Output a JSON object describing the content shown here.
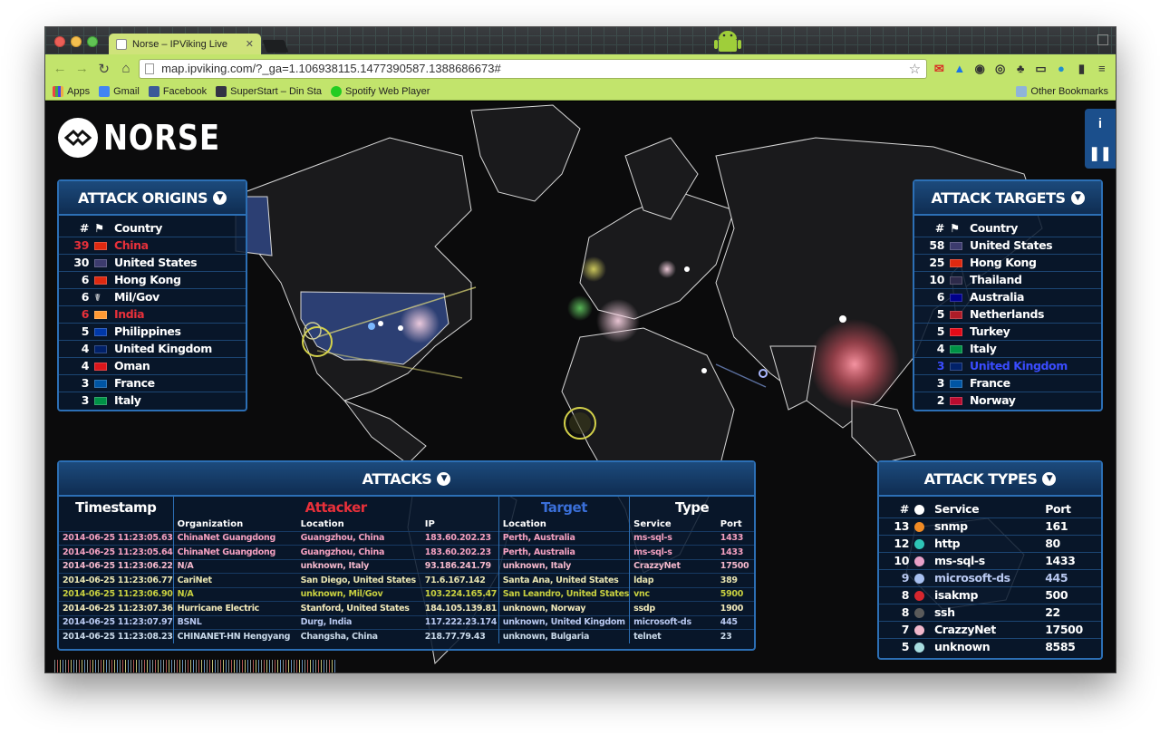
{
  "browser": {
    "tab_title": "Norse – IPViking Live",
    "url": "map.ipviking.com/?_ga=1.106938115.1477390587.1388686673#",
    "bookmarks": [
      "Apps",
      "Gmail",
      "Facebook",
      "SuperStart – Din Sta",
      "Spotify Web Player"
    ],
    "other_bookmarks": "Other Bookmarks"
  },
  "logo": {
    "text": "NORSE"
  },
  "side_buttons": {
    "info": "i",
    "pause": "❚❚"
  },
  "origins": {
    "title": "ATTACK ORIGINS",
    "col_num": "#",
    "col_country": "Country",
    "rows": [
      {
        "count": "39",
        "country": "China",
        "flag_color": "#de2910",
        "highlight": "#e8303a"
      },
      {
        "count": "30",
        "country": "United States",
        "flag_color": "#3c3b6e",
        "highlight": ""
      },
      {
        "count": "6",
        "country": "Hong Kong",
        "flag_color": "#de2910",
        "highlight": ""
      },
      {
        "count": "6",
        "country": "Mil/Gov",
        "flag_color": "",
        "highlight": ""
      },
      {
        "count": "6",
        "country": "India",
        "flag_color": "#ff9933",
        "highlight": "#e8303a"
      },
      {
        "count": "5",
        "country": "Philippines",
        "flag_color": "#0038a8",
        "highlight": ""
      },
      {
        "count": "4",
        "country": "United Kingdom",
        "flag_color": "#012169",
        "highlight": ""
      },
      {
        "count": "4",
        "country": "Oman",
        "flag_color": "#db161b",
        "highlight": ""
      },
      {
        "count": "3",
        "country": "France",
        "flag_color": "#0055a4",
        "highlight": ""
      },
      {
        "count": "3",
        "country": "Italy",
        "flag_color": "#009246",
        "highlight": ""
      }
    ]
  },
  "targets": {
    "title": "ATTACK TARGETS",
    "col_num": "#",
    "col_country": "Country",
    "rows": [
      {
        "count": "58",
        "country": "United States",
        "flag_color": "#3c3b6e",
        "highlight": ""
      },
      {
        "count": "25",
        "country": "Hong Kong",
        "flag_color": "#de2910",
        "highlight": ""
      },
      {
        "count": "10",
        "country": "Thailand",
        "flag_color": "#2d2a4a",
        "highlight": ""
      },
      {
        "count": "6",
        "country": "Australia",
        "flag_color": "#00008b",
        "highlight": ""
      },
      {
        "count": "5",
        "country": "Netherlands",
        "flag_color": "#ae1c28",
        "highlight": ""
      },
      {
        "count": "5",
        "country": "Turkey",
        "flag_color": "#e30a17",
        "highlight": ""
      },
      {
        "count": "4",
        "country": "Italy",
        "flag_color": "#009246",
        "highlight": ""
      },
      {
        "count": "3",
        "country": "United Kingdom",
        "flag_color": "#012169",
        "highlight": "#3a4cff"
      },
      {
        "count": "3",
        "country": "France",
        "flag_color": "#0055a4",
        "highlight": ""
      },
      {
        "count": "2",
        "country": "Norway",
        "flag_color": "#ba0c2f",
        "highlight": ""
      }
    ]
  },
  "attack_types": {
    "title": "ATTACK TYPES",
    "col_num": "#",
    "col_service": "Service",
    "col_port": "Port",
    "rows": [
      {
        "count": "13",
        "service": "snmp",
        "port": "161",
        "dot": "#f08a24",
        "text_color": "#ffffff"
      },
      {
        "count": "12",
        "service": "http",
        "port": "80",
        "dot": "#2ec4b6",
        "text_color": "#ffffff"
      },
      {
        "count": "10",
        "service": "ms-sql-s",
        "port": "1433",
        "dot": "#e8a0c8",
        "text_color": "#ffffff"
      },
      {
        "count": "9",
        "service": "microsoft-ds",
        "port": "445",
        "dot": "#a8c0f0",
        "text_color": "#b8c8f0"
      },
      {
        "count": "8",
        "service": "isakmp",
        "port": "500",
        "dot": "#d6262e",
        "text_color": "#ffffff"
      },
      {
        "count": "8",
        "service": "ssh",
        "port": "22",
        "dot": "#5a5a5a",
        "text_color": "#ffffff"
      },
      {
        "count": "7",
        "service": "CrazzyNet",
        "port": "17500",
        "dot": "#f2b8cc",
        "text_color": "#ffffff"
      },
      {
        "count": "5",
        "service": "unknown",
        "port": "8585",
        "dot": "#a8dde0",
        "text_color": "#ffffff"
      }
    ]
  },
  "attacks": {
    "title": "ATTACKS",
    "group_timestamp": "Timestamp",
    "group_attacker": "Attacker",
    "group_target": "Target",
    "group_type": "Type",
    "sub_organization": "Organization",
    "sub_location": "Location",
    "sub_ip": "IP",
    "sub_target_location": "Location",
    "sub_service": "Service",
    "sub_port": "Port",
    "attacker_color": "#e8303a",
    "target_color": "#3a6fd8",
    "rows": [
      {
        "timestamp": "2014-06-25 11:23:05.63",
        "org": "ChinaNet Guangdong",
        "location": "Guangzhou, China",
        "ip": "183.60.202.23",
        "target": "Perth, Australia",
        "service": "ms-sql-s",
        "port": "1433",
        "color": "#f4a0c0"
      },
      {
        "timestamp": "2014-06-25 11:23:05.64",
        "org": "ChinaNet Guangdong",
        "location": "Guangzhou, China",
        "ip": "183.60.202.23",
        "target": "Perth, Australia",
        "service": "ms-sql-s",
        "port": "1433",
        "color": "#f4a0c0"
      },
      {
        "timestamp": "2014-06-25 11:23:06.22",
        "org": "N/A",
        "location": "unknown, Italy",
        "ip": "93.186.241.79",
        "target": "unknown, Italy",
        "service": "CrazzyNet",
        "port": "17500",
        "color": "#f4b8cc"
      },
      {
        "timestamp": "2014-06-25 11:23:06.77",
        "org": "CariNet",
        "location": "San Diego, United States",
        "ip": "71.6.167.142",
        "target": "Santa Ana, United States",
        "service": "ldap",
        "port": "389",
        "color": "#e8e4b0"
      },
      {
        "timestamp": "2014-06-25 11:23:06.90",
        "org": "N/A",
        "location": "unknown, Mil/Gov",
        "ip": "103.224.165.47",
        "target": "San Leandro, United States",
        "service": "vnc",
        "port": "5900",
        "color": "#c8d040"
      },
      {
        "timestamp": "2014-06-25 11:23:07.36",
        "org": "Hurricane Electric",
        "location": "Stanford, United States",
        "ip": "184.105.139.81",
        "target": "unknown, Norway",
        "service": "ssdp",
        "port": "1900",
        "color": "#f0e8b8"
      },
      {
        "timestamp": "2014-06-25 11:23:07.97",
        "org": "BSNL",
        "location": "Durg, India",
        "ip": "117.222.23.174",
        "target": "unknown, United Kingdom",
        "service": "microsoft-ds",
        "port": "445",
        "color": "#b8c8f0"
      },
      {
        "timestamp": "2014-06-25 11:23:08.23",
        "org": "CHINANET-HN Hengyang",
        "location": "Changsha, China",
        "ip": "218.77.79.43",
        "target": "unknown, Bulgaria",
        "service": "telnet",
        "port": "23",
        "color": "#c8d8e8"
      }
    ]
  }
}
